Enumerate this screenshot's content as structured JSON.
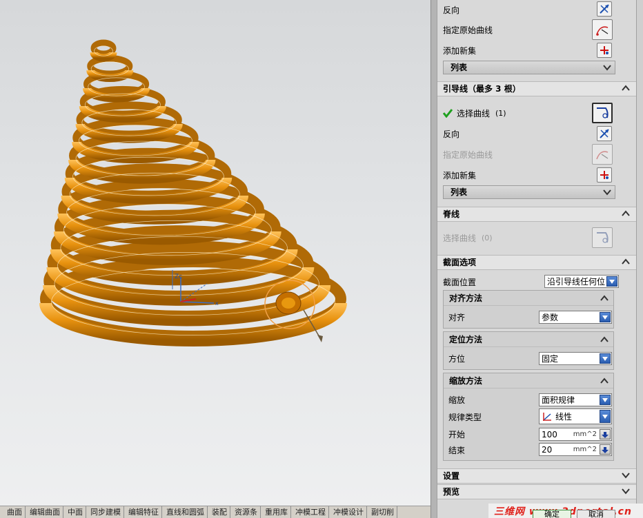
{
  "viewport": {
    "wcs_label": "Zc"
  },
  "tabs": [
    "曲面",
    "编辑曲面",
    "中面",
    "同步建模",
    "编辑特征",
    "直线和圆弧",
    "装配",
    "资源条",
    "重用库",
    "冲模工程",
    "冲模设计",
    "副切削"
  ],
  "section_curves_top": {
    "reverse_label": "反向",
    "specify_origin_label": "指定原始曲线",
    "add_new_set_label": "添加新集",
    "list_label": "列表"
  },
  "guide": {
    "title": "引导线（最多 3 根）",
    "select_curve_label": "选择曲线",
    "select_curve_count": "(1)",
    "reverse_label": "反向",
    "specify_origin_label": "指定原始曲线",
    "add_new_set_label": "添加新集",
    "list_label": "列表"
  },
  "spine": {
    "title": "脊线",
    "select_curve_label": "选择曲线",
    "select_curve_count": "(0)"
  },
  "section_options": {
    "title": "截面选项",
    "position_label": "截面位置",
    "position_value": "沿引导线任何位",
    "align": {
      "title": "对齐方法",
      "label": "对齐",
      "value": "参数"
    },
    "orient": {
      "title": "定位方法",
      "label": "方位",
      "value": "固定"
    },
    "scale": {
      "title": "缩放方法",
      "scale_label": "缩放",
      "scale_value": "面积规律",
      "law_type_label": "规律类型",
      "law_type_value": "线性",
      "start_label": "开始",
      "start_value": "100",
      "start_unit": "mm^2",
      "end_label": "结束",
      "end_value": "20",
      "end_unit": "mm^2"
    }
  },
  "settings": {
    "title": "设置"
  },
  "preview": {
    "title": "预览"
  },
  "footer": {
    "ok_label": "确定",
    "cancel_label": "取消",
    "watermark": "三维网 www.3dportal.cn"
  }
}
